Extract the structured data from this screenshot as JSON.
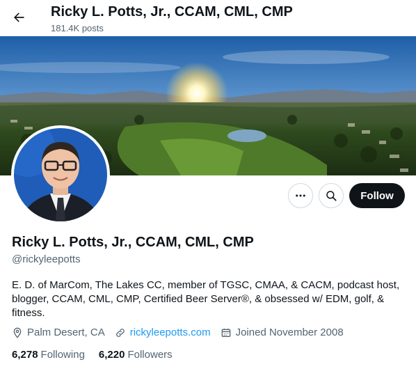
{
  "header": {
    "title": "Ricky L. Potts, Jr., CCAM, CML, CMP",
    "post_count": "181.4K posts"
  },
  "profile": {
    "display_name": "Ricky L. Potts, Jr., CCAM, CML, CMP",
    "handle": "@rickyleepotts",
    "bio": "E. D. of MarCom, The Lakes CC, member of TGSC, CMAA, & CACM, podcast host, blogger, CCAM, CML, CMP, Certified Beer Server®, & obsessed w/ EDM, golf, & fitness.",
    "location": "Palm Desert, CA",
    "website": "rickyleepotts.com",
    "joined": "Joined November 2008",
    "following_count": "6,278",
    "following_label": "Following",
    "followers_count": "6,220",
    "followers_label": "Followers"
  },
  "actions": {
    "follow_label": "Follow"
  },
  "icons": {
    "back": "back-arrow-icon",
    "more": "more-icon",
    "search": "search-icon",
    "location": "location-pin-icon",
    "link": "link-icon",
    "calendar": "calendar-icon"
  },
  "colors": {
    "accent": "#1d9bf0",
    "text": "#0f1419",
    "muted": "#536471",
    "follow_bg": "#0f1419"
  }
}
